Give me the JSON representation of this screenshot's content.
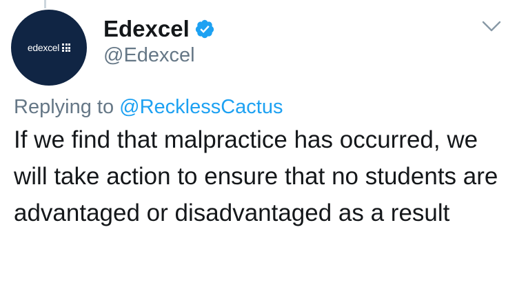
{
  "tweet": {
    "author": {
      "display_name": "Edexcel",
      "handle": "@Edexcel",
      "avatar_text": "edexcel",
      "verified": true
    },
    "reply": {
      "prefix": "Replying to ",
      "to_handle": "@RecklessCactus"
    },
    "text": "If we find that malpractice has occurred, we will take action to ensure that no students are advantaged or disadvantaged as a result"
  },
  "icons": {
    "verified": "verified-badge-icon",
    "menu": "chevron-down-icon"
  },
  "colors": {
    "verified_blue": "#1da1f2",
    "link_blue": "#1da1f2",
    "avatar_bg": "#102544",
    "secondary_text": "#657786",
    "primary_text": "#14171a"
  }
}
